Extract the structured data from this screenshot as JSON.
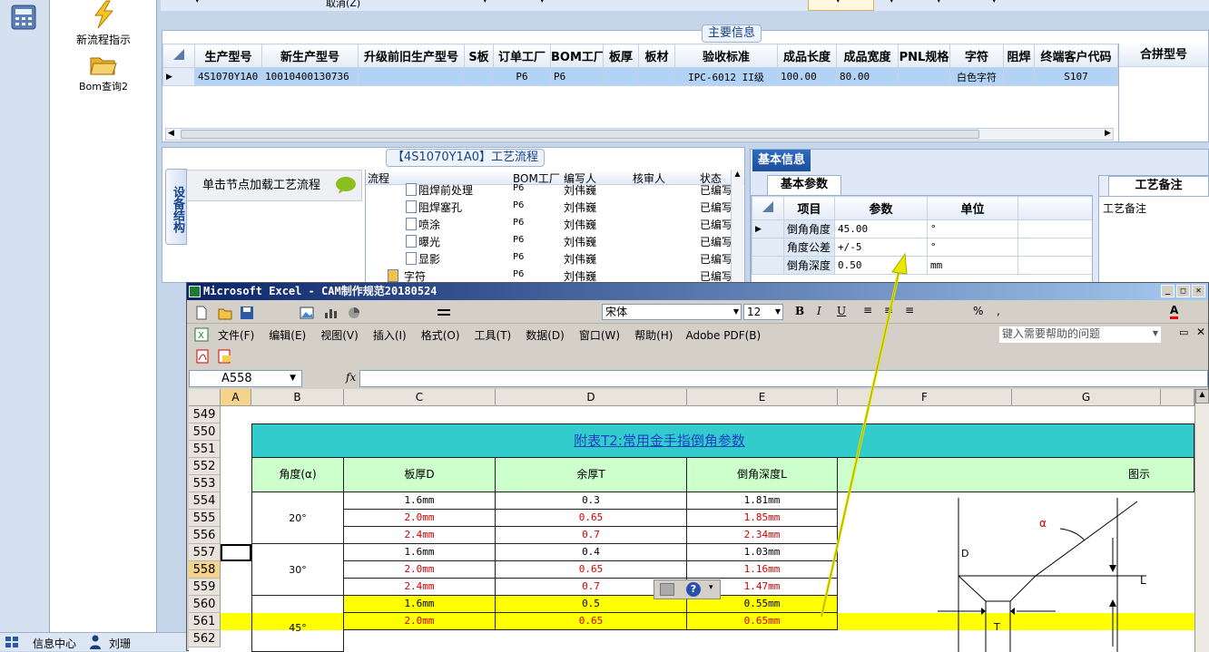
{
  "left_nav": {
    "items": [
      {
        "label": "新流程指示",
        "icon": "lightning-icon"
      },
      {
        "label": "Bom查询2",
        "icon": "folder-open-icon"
      }
    ]
  },
  "status_bar": {
    "info_center": "信息中心",
    "user": "刘珊"
  },
  "top_toolbar": {
    "cancel_label": "取消(Z)"
  },
  "main_info": {
    "group_label": "主要信息",
    "columns": [
      "生产型号",
      "新生产型号",
      "升级前旧生产型号",
      "S板",
      "订单工厂",
      "BOM工厂",
      "板厚",
      "板材",
      "验收标准",
      "成品长度",
      "成品宽度",
      "PNL规格",
      "字符",
      "阻焊",
      "终端客户代码"
    ],
    "row": [
      "4S1070Y1A0",
      "10010400130736",
      "",
      "",
      "P6",
      "P6",
      "",
      "",
      "IPC-6012 II级",
      "100.00",
      "80.00",
      "",
      "白色字符",
      "",
      "S107"
    ],
    "side_header": "合拼型号"
  },
  "flow": {
    "group_label": "【4S1070Y1A0】工艺流程",
    "side_tab": "设备结构",
    "load_hint": "单击节点加载工艺流程",
    "columns": [
      "流程",
      "BOM工厂",
      "编写人",
      "核审人",
      "状态"
    ],
    "rows": [
      {
        "name": "阻焊前处理",
        "factory": "P6",
        "writer": "刘伟巍",
        "reviewer": "",
        "status": "已编写"
      },
      {
        "name": "阻焊塞孔",
        "factory": "P6",
        "writer": "刘伟巍",
        "reviewer": "",
        "status": "已编写"
      },
      {
        "name": "喷涂",
        "factory": "P6",
        "writer": "刘伟巍",
        "reviewer": "",
        "status": "已编写"
      },
      {
        "name": "曝光",
        "factory": "P6",
        "writer": "刘伟巍",
        "reviewer": "",
        "status": "已编写"
      },
      {
        "name": "显影",
        "factory": "P6",
        "writer": "刘伟巍",
        "reviewer": "",
        "status": "已编写"
      },
      {
        "name": "字符",
        "factory": "P6",
        "writer": "刘伟巍",
        "reviewer": "",
        "status": "已编写"
      }
    ]
  },
  "basic_info": {
    "tab_label": "基本信息",
    "sub_tab": "基本参数",
    "columns": [
      "项目",
      "参数",
      "单位"
    ],
    "rows": [
      {
        "item": "倒角角度",
        "param": "45.00",
        "unit": "°"
      },
      {
        "item": "角度公差",
        "param": "+/-5",
        "unit": "°"
      },
      {
        "item": "倒角深度",
        "param": "0.50",
        "unit": "mm"
      }
    ],
    "remark_tab": "工艺备注",
    "remark_header": "工艺备注"
  },
  "excel": {
    "title": "Microsoft Excel - CAM制作规范20180524",
    "menus": [
      "文件(F)",
      "编辑(E)",
      "视图(V)",
      "插入(I)",
      "格式(O)",
      "工具(T)",
      "数据(D)",
      "窗口(W)",
      "帮助(H)",
      "Adobe PDF(B)"
    ],
    "font_name": "宋体",
    "font_size": "12",
    "help_placeholder": "键入需要帮助的问题",
    "name_box": "A558",
    "fx": "fx",
    "col_headers": [
      "A",
      "B",
      "C",
      "D",
      "E",
      "F",
      "G"
    ],
    "row_numbers": [
      "549",
      "550",
      "551",
      "552",
      "553",
      "554",
      "555",
      "556",
      "557",
      "558",
      "559",
      "560",
      "561",
      "562"
    ],
    "table_title": "附表T2:常用金手指倒角参数",
    "table_headers": [
      "角度(α)",
      "板厚D",
      "余厚T",
      "倒角深度L",
      "图示"
    ],
    "angles": [
      "20°",
      "30°",
      "45°"
    ],
    "rows": [
      {
        "d": "1.6mm",
        "t": "0.3",
        "l": "1.81mm",
        "red": false
      },
      {
        "d": "2.0mm",
        "t": "0.65",
        "l": "1.85mm",
        "red": true
      },
      {
        "d": "2.4mm",
        "t": "0.7",
        "l": "2.34mm",
        "red": true
      },
      {
        "d": "1.6mm",
        "t": "0.4",
        "l": "1.03mm",
        "red": false
      },
      {
        "d": "2.0mm",
        "t": "0.65",
        "l": "1.16mm",
        "red": true
      },
      {
        "d": "2.4mm",
        "t": "0.7",
        "l": "1.47mm",
        "red": true
      },
      {
        "d": "1.6mm",
        "t": "0.5",
        "l": "0.55mm",
        "red": false
      },
      {
        "d": "2.0mm",
        "t": "0.65",
        "l": "0.65mm",
        "red": true
      }
    ],
    "diagram_labels": {
      "alpha": "α",
      "d": "D",
      "l": "L",
      "t": "T"
    }
  }
}
